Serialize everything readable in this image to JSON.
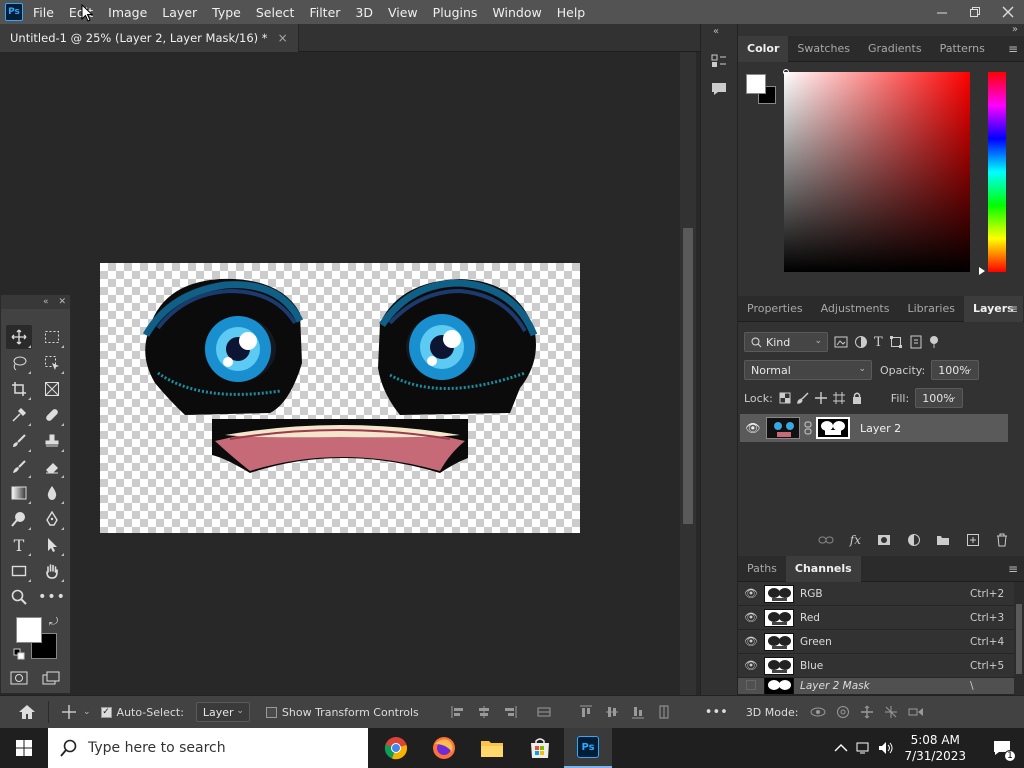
{
  "app": {
    "logo_text": "Ps"
  },
  "menu": [
    "File",
    "Edit",
    "Image",
    "Layer",
    "Type",
    "Select",
    "Filter",
    "3D",
    "View",
    "Plugins",
    "Window",
    "Help"
  ],
  "document_tab": {
    "title": "Untitled-1 @ 25% (Layer 2, Layer Mask/16) *",
    "close": "×"
  },
  "color_panel": {
    "tabs": [
      "Color",
      "Swatches",
      "Gradients",
      "Patterns"
    ],
    "active": "Color"
  },
  "mid_panel": {
    "tabs": [
      "Properties",
      "Adjustments",
      "Libraries",
      "Layers"
    ],
    "active": "Layers"
  },
  "layers": {
    "filter_kind": "Kind",
    "blend_mode": "Normal",
    "opacity_label": "Opacity:",
    "opacity_value": "100%",
    "lock_label": "Lock:",
    "fill_label": "Fill:",
    "fill_value": "100%",
    "items": [
      {
        "name": "Layer 2",
        "visible": true
      }
    ]
  },
  "bottom_panel": {
    "tabs": [
      "Paths",
      "Channels"
    ],
    "active": "Channels"
  },
  "channels": [
    {
      "name": "RGB",
      "shortcut": "Ctrl+2"
    },
    {
      "name": "Red",
      "shortcut": "Ctrl+3"
    },
    {
      "name": "Green",
      "shortcut": "Ctrl+4"
    },
    {
      "name": "Blue",
      "shortcut": "Ctrl+5"
    },
    {
      "name": "Layer 2 Mask",
      "shortcut": "\\"
    }
  ],
  "options_bar": {
    "auto_select_label": "Auto-Select:",
    "auto_select_target": "Layer",
    "show_transform_label": "Show Transform Controls",
    "mode_3d_label": "3D Mode:"
  },
  "taskbar": {
    "search_placeholder": "Type here to search",
    "time": "5:08 AM",
    "date": "7/31/2023",
    "notification_count": "1"
  },
  "colors": {
    "foreground": "#ffffff",
    "background": "#000000",
    "accent": "#31a8ff"
  }
}
